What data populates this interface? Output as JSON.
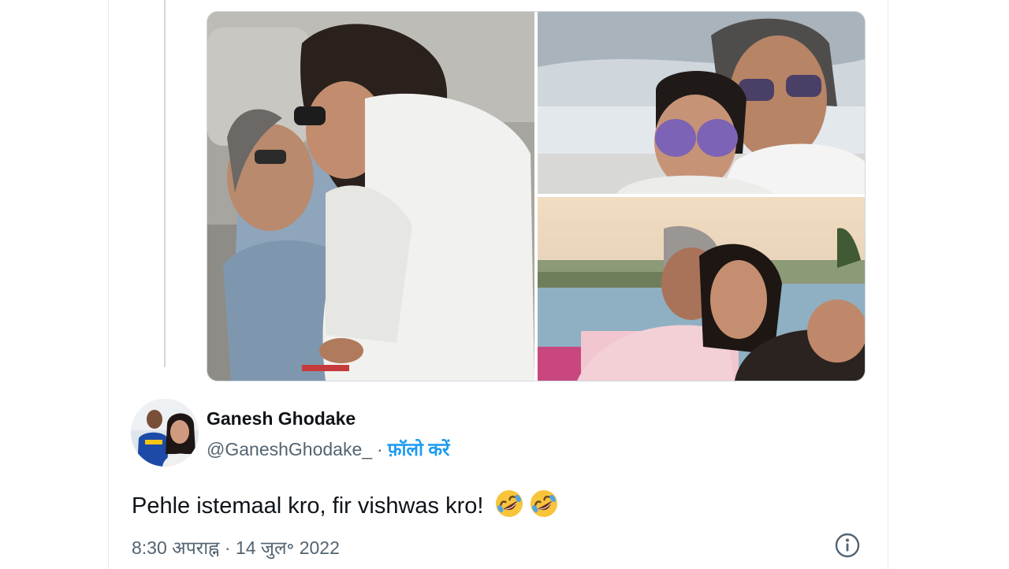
{
  "tweet": {
    "author_name": "Ganesh Ghodake",
    "author_handle": "@GaneshGhodake_",
    "separator": "·",
    "follow_label": "फ़ॉलो करें",
    "text": "Pehle istemaal kro, fir vishwas kro!",
    "emoji": [
      "rolling-on-floor-laughing-emoji",
      "rolling-on-floor-laughing-emoji"
    ],
    "timestamp": "8:30 अपराह्न · 14 जुल॰ 2022",
    "media_count": 3
  },
  "icons": {
    "info": "info-icon"
  },
  "colors": {
    "accent": "#1d9bf0",
    "text_primary": "#0f1419",
    "text_secondary": "#536471",
    "border": "#cfd9de",
    "emoji_yellow": "#f7c43c"
  }
}
